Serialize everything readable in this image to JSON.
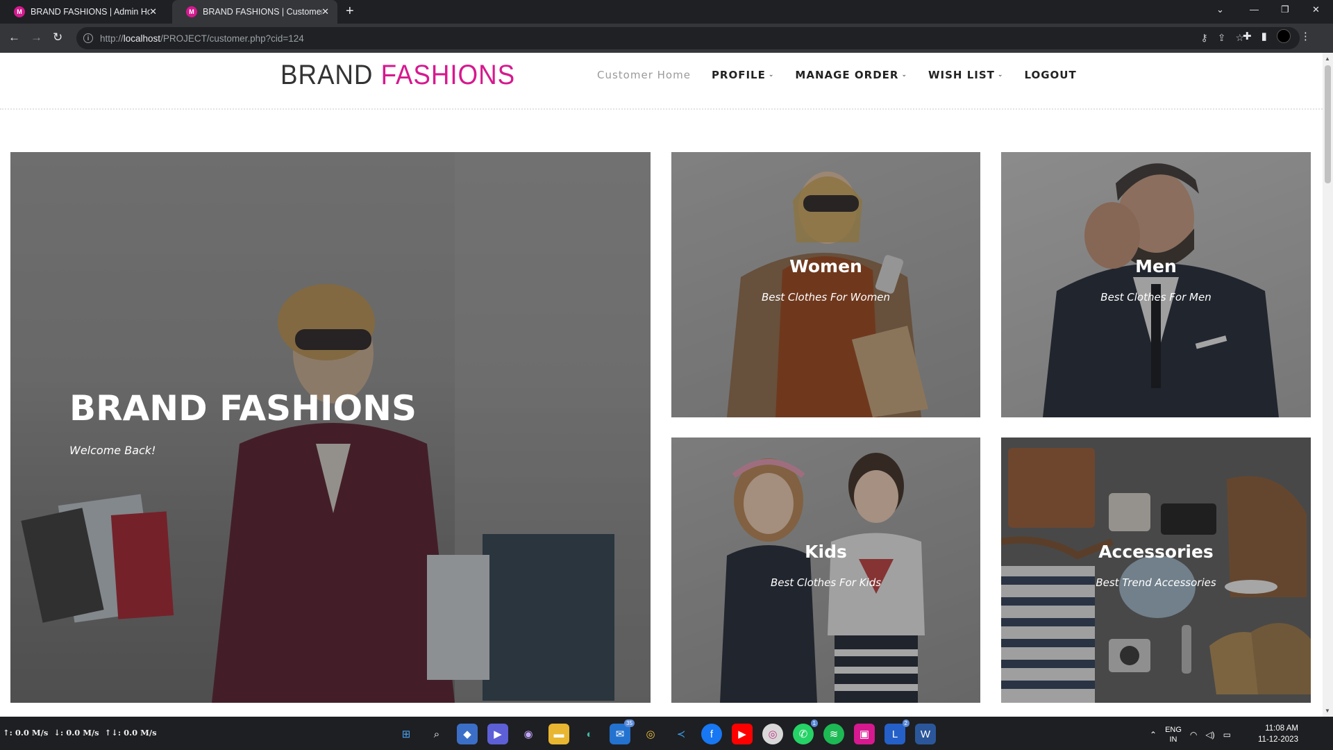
{
  "browser": {
    "tabs": [
      {
        "label": "BRAND FASHIONS | Admin Hom",
        "favicon": "brand-fashions-favicon",
        "active": false
      },
      {
        "label": "BRAND FASHIONS | Customer H",
        "favicon": "brand-fashions-favicon",
        "active": true
      }
    ],
    "new_tab_glyph": "+",
    "url_prefix": "http://",
    "url_host": "localhost",
    "url_path": "/PROJECT/customer.php?cid=124"
  },
  "site": {
    "logo_brand": "BRAND",
    "logo_fashions": "FASHIONS",
    "menu": [
      {
        "label": "Customer Home",
        "has_dropdown": false
      },
      {
        "label": "PROFILE",
        "has_dropdown": true
      },
      {
        "label": "MANAGE ORDER",
        "has_dropdown": true
      },
      {
        "label": "WISH LIST",
        "has_dropdown": true
      },
      {
        "label": "LOGOUT",
        "has_dropdown": false
      }
    ],
    "hero": {
      "title": "BRAND FASHIONS",
      "subtitle": "Welcome Back!"
    },
    "categories": [
      {
        "title": "Women",
        "subtitle": "Best Clothes For Women"
      },
      {
        "title": "Men",
        "subtitle": "Best Clothes For Men"
      },
      {
        "title": "Kids",
        "subtitle": "Best Clothes For Kids"
      },
      {
        "title": "Accessories",
        "subtitle": "Best Trend Accessories"
      }
    ]
  },
  "taskbar": {
    "netspeed": [
      "↑: 0.0 M/s",
      "↓: 0.0 M/s",
      "↑↓: 0.0 M/s"
    ],
    "badges": {
      "mail": "35",
      "whatsapp": "1",
      "lapp": "2"
    },
    "lang_top": "ENG",
    "lang_bottom": "IN",
    "time": "11:08 AM",
    "date": "11-12-2023"
  },
  "colors": {
    "brand_accent": "#d6198f",
    "chrome_dark": "#35363a",
    "taskbar": "#1e1f22"
  }
}
